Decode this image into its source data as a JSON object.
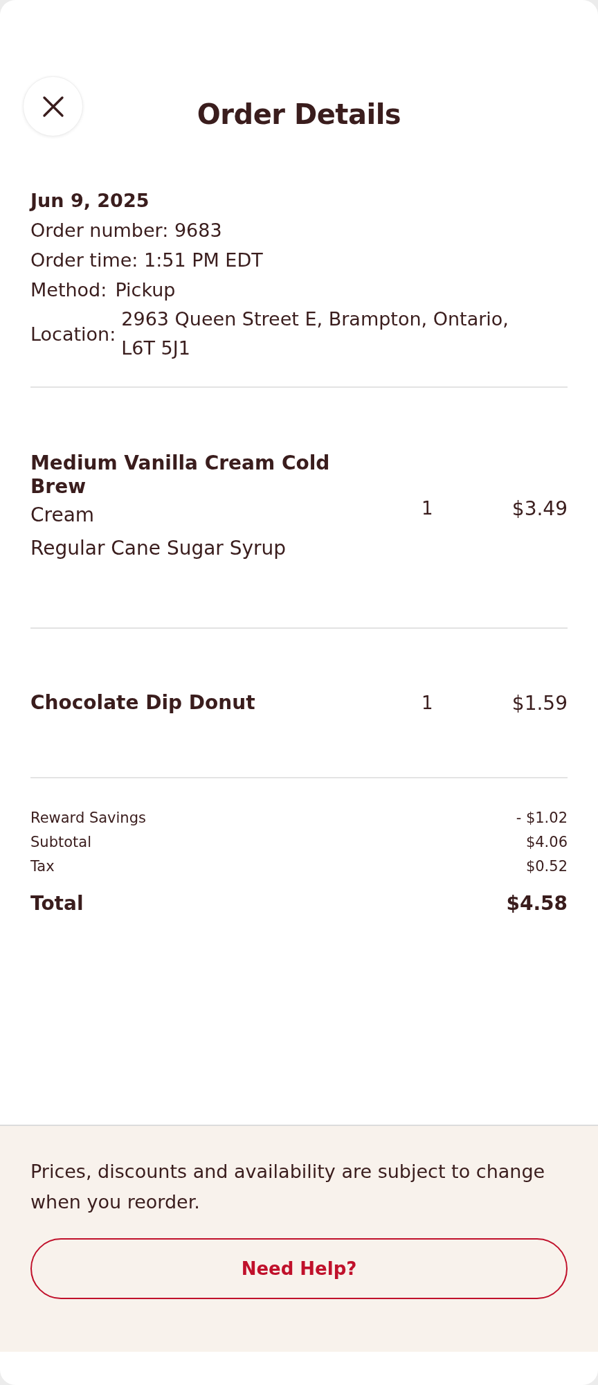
{
  "header": {
    "title": "Order Details"
  },
  "order": {
    "date": "Jun 9, 2025",
    "number": "Order number: 9683",
    "time": "Order time: 1:51 PM EDT",
    "method_label": "Method:",
    "method": "Pickup",
    "location_label": "Location:",
    "location": "2963 Queen Street E, Brampton, Ontario, L6T 5J1"
  },
  "items": [
    {
      "name": "Medium Vanilla Cream Cold Brew",
      "options": [
        "Cream",
        "Regular Cane Sugar Syrup"
      ],
      "quantity": "1",
      "price": "$3.49"
    },
    {
      "name": "Chocolate Dip Donut",
      "quantity": "1",
      "price": "$1.59"
    }
  ],
  "summary": [
    {
      "label": "Reward Savings",
      "value": "- $1.02"
    },
    {
      "label": "Subtotal",
      "value": "$4.06"
    },
    {
      "label": "Tax",
      "value": "$0.52"
    }
  ],
  "total": {
    "label": "Total",
    "value": "$4.58"
  },
  "footer": {
    "notice": "Prices, discounts and availability are subject to change when you reorder.",
    "button": "Need Help?"
  }
}
